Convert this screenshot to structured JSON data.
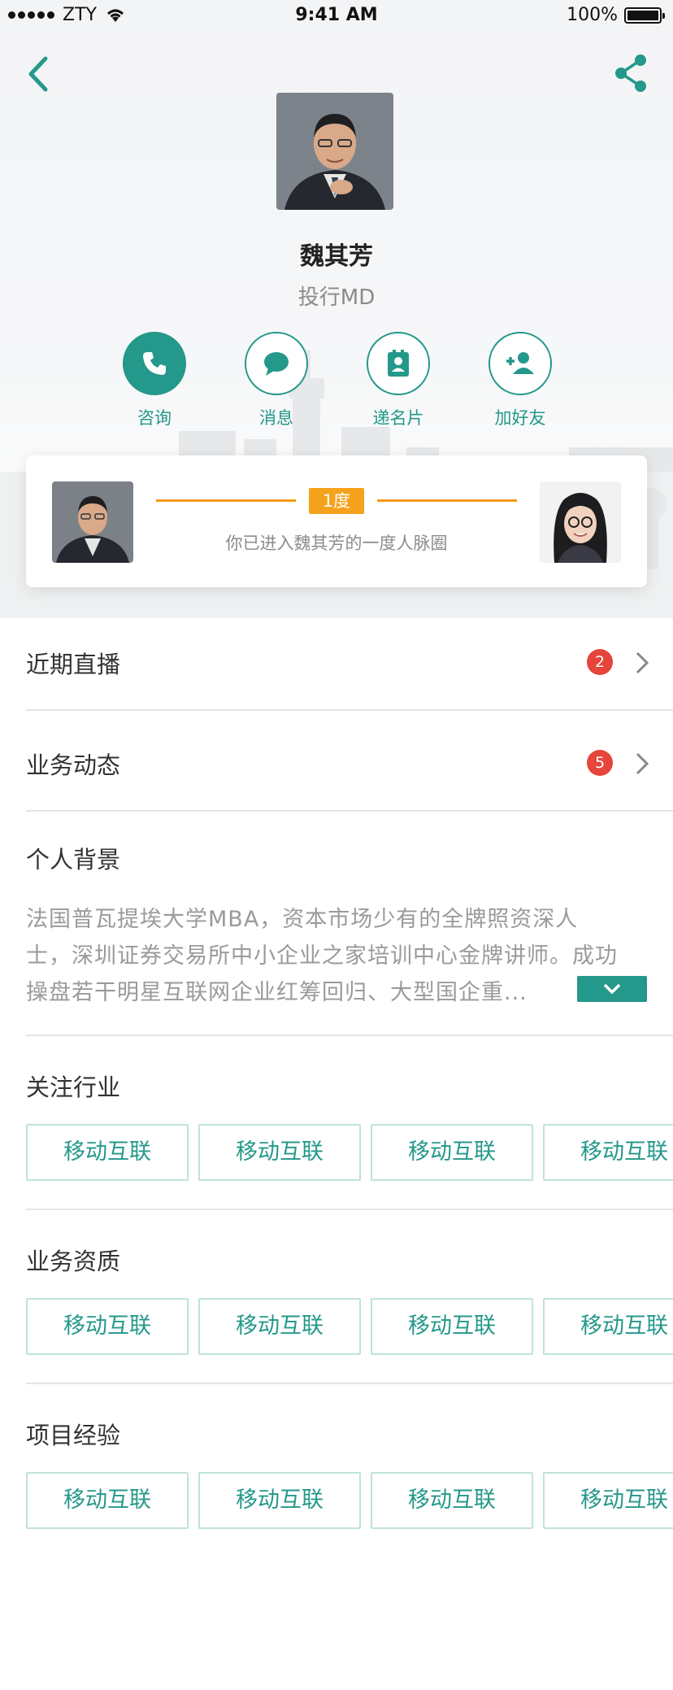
{
  "status_bar": {
    "carrier": "ZTY",
    "time": "9:41 AM",
    "battery": "100%"
  },
  "profile": {
    "name": "魏其芳",
    "title": "投行MD"
  },
  "actions": [
    {
      "label": "咨询",
      "icon": "phone-icon"
    },
    {
      "label": "消息",
      "icon": "chat-bubble-icon"
    },
    {
      "label": "递名片",
      "icon": "contact-card-icon"
    },
    {
      "label": "加好友",
      "icon": "add-friend-icon"
    }
  ],
  "connection": {
    "degree": "1度",
    "text": "你已进入魏其芳的一度人脉圈"
  },
  "rows": [
    {
      "label": "近期直播",
      "badge": "2"
    },
    {
      "label": "业务动态",
      "badge": "5"
    }
  ],
  "background": {
    "title": "个人背景",
    "lines": [
      "法国普瓦提埃大学MBA，资本市场少有的全牌照资深人",
      "士，深圳证券交易所中小企业之家培训中心金牌讲师。成功",
      "操盘若干明星互联网企业红筹回归、大型国企重..."
    ]
  },
  "sections": [
    {
      "title": "关注行业",
      "tags": [
        "移动互联",
        "移动互联",
        "移动互联",
        "移动互联"
      ]
    },
    {
      "title": "业务资质",
      "tags": [
        "移动互联",
        "移动互联",
        "移动互联",
        "移动互联"
      ]
    },
    {
      "title": "项目经验",
      "tags": [
        "移动互联",
        "移动互联",
        "移动互联",
        "移动互联"
      ]
    }
  ],
  "colors": {
    "accent": "#24988a",
    "badge": "#e5453a",
    "degree": "#f5a21c"
  }
}
